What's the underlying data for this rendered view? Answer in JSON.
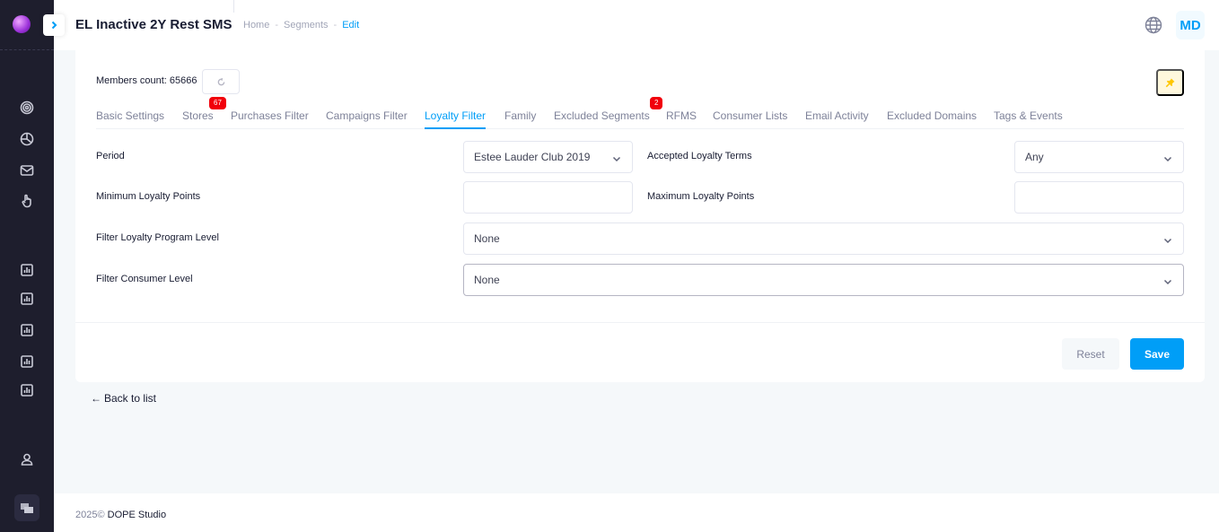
{
  "header": {
    "title": "EL Inactive 2Y Rest SMS",
    "breadcrumb": [
      "Home",
      "Segments",
      "Edit"
    ],
    "avatar_initials": "MD"
  },
  "sidebar": {
    "icons": [
      "target-icon",
      "pie-chart-icon",
      "mail-icon",
      "hand-pointer-icon",
      "report-icon",
      "report-icon",
      "report-icon",
      "report-icon",
      "report-icon",
      "user-icon"
    ]
  },
  "members": {
    "label": "Members count: 65666"
  },
  "tabs": [
    {
      "label": "Basic Settings",
      "active": false
    },
    {
      "label": "Stores",
      "active": false,
      "badge": "67"
    },
    {
      "label": "Purchases Filter",
      "active": false
    },
    {
      "label": "Campaigns Filter",
      "active": false
    },
    {
      "label": "Loyalty Filter",
      "active": true
    },
    {
      "label": "Family",
      "active": false
    },
    {
      "label": "Excluded Segments",
      "active": false,
      "badge": "2"
    },
    {
      "label": "RFMS",
      "active": false
    },
    {
      "label": "Consumer Lists",
      "active": false
    },
    {
      "label": "Email Activity",
      "active": false
    },
    {
      "label": "Excluded Domains",
      "active": false
    },
    {
      "label": "Tags & Events",
      "active": false
    }
  ],
  "form": {
    "period_label": "Period",
    "period_value": "Estee Lauder Club 2019",
    "accepted_terms_label": "Accepted Loyalty Terms",
    "accepted_terms_value": "Any",
    "min_points_label": "Minimum Loyalty Points",
    "min_points_value": "",
    "max_points_label": "Maximum Loyalty Points",
    "max_points_value": "",
    "program_level_label": "Filter Loyalty Program Level",
    "program_level_value": "None",
    "consumer_level_label": "Filter Consumer Level",
    "consumer_level_value": "None"
  },
  "actions": {
    "reset_label": "Reset",
    "save_label": "Save",
    "back_label": "Back to list"
  },
  "footer": {
    "year": "2025©",
    "brand": "DOPE Studio"
  },
  "colors": {
    "accent": "#009ef7",
    "sidebar": "#1e1e2d",
    "badge": "#f1000b"
  }
}
